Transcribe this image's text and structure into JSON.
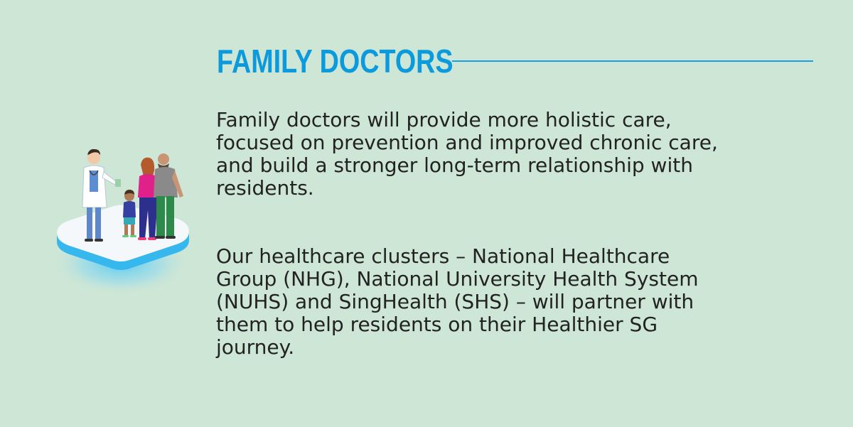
{
  "title": "FAMILY DOCTORS",
  "paragraph1": [
    "Family doctors will provide more holistic care,",
    "focused on prevention and improved chronic care,",
    "and build a stronger long-term relationship with",
    "residents."
  ],
  "paragraph2": [
    "Our healthcare clusters – National Healthcare",
    "Group (NHG), National University Health System",
    "(NUHS) and SingHealth (SHS) – will partner with",
    "them to help residents on their Healthier SG",
    "journey."
  ],
  "colors": {
    "background": "#cde6d6",
    "title": "#0b9bdc",
    "text": "#222222",
    "platform_glow": "#5cc8f0"
  },
  "illustration": "doctor-with-family-icon"
}
